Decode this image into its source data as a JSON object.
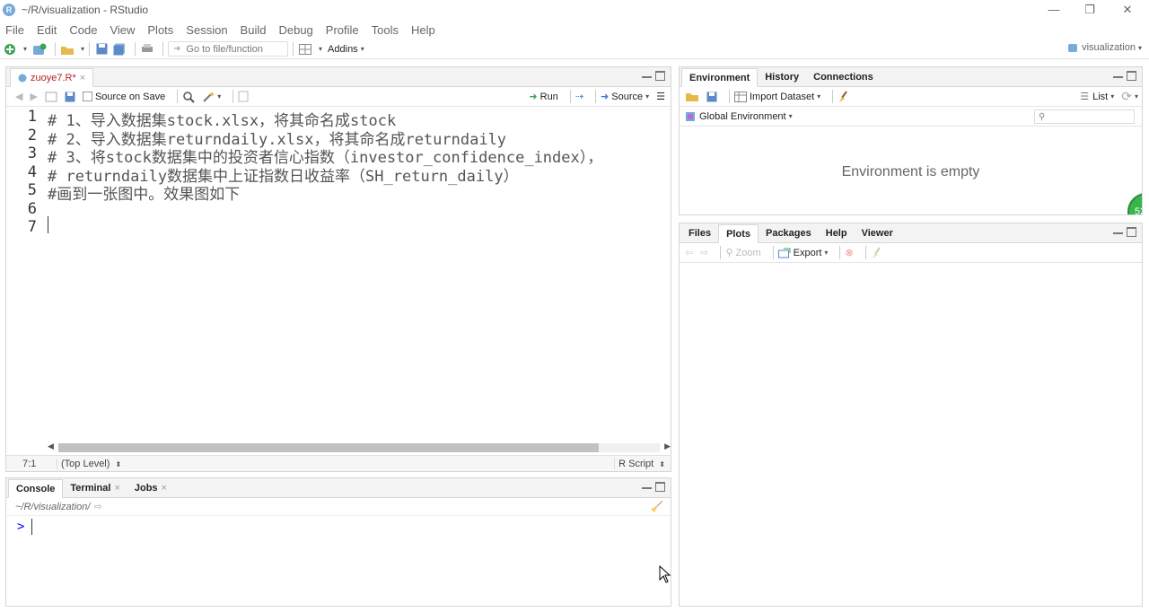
{
  "window": {
    "title": "~/R/visualization - RStudio",
    "r_logo": "R",
    "user_label": "visualization",
    "controls": {
      "minimize": "—",
      "restore": "❐",
      "close": "✕"
    }
  },
  "menu": [
    {
      "label": "File"
    },
    {
      "label": "Edit"
    },
    {
      "label": "Code"
    },
    {
      "label": "View"
    },
    {
      "label": "Plots"
    },
    {
      "label": "Session"
    },
    {
      "label": "Build"
    },
    {
      "label": "Debug"
    },
    {
      "label": "Profile"
    },
    {
      "label": "Tools"
    },
    {
      "label": "Help"
    }
  ],
  "toolbar": {
    "goto_placeholder": "Go to file/function",
    "addins_label": "Addins"
  },
  "editor": {
    "tab_label": "zuoye7.R*",
    "source_on_save": "Source on Save",
    "run_label": "Run",
    "source_label": "Source",
    "line_numbers": [
      "1",
      "2",
      "3",
      "4",
      "5",
      "6",
      "7"
    ],
    "lines": [
      "# 1、导入数据集stock.xlsx，将其命名成stock",
      "# 2、导入数据集returndaily.xlsx，将其命名成returndaily",
      "# 3、将stock数据集中的投资者信心指数（investor_confidence_index），",
      "# returndaily数据集中上证指数日收益率（SH_return_daily）",
      "#画到一张图中。效果图如下",
      "",
      ""
    ],
    "status_position": "7:1",
    "status_scope": "(Top Level)",
    "status_type": "R Script"
  },
  "console": {
    "tabs": [
      {
        "label": "Console"
      },
      {
        "label": "Terminal"
      },
      {
        "label": "Jobs"
      }
    ],
    "path": "~/R/visualization/",
    "prompt": ">"
  },
  "environment": {
    "tabs": [
      {
        "label": "Environment"
      },
      {
        "label": "History"
      },
      {
        "label": "Connections"
      }
    ],
    "import_dataset": "Import Dataset",
    "list_label": "List",
    "scope": "Global Environment",
    "empty_message": "Environment is empty",
    "badge": "52"
  },
  "files": {
    "tabs": [
      {
        "label": "Files"
      },
      {
        "label": "Plots"
      },
      {
        "label": "Packages"
      },
      {
        "label": "Help"
      },
      {
        "label": "Viewer"
      }
    ],
    "zoom_label": "Zoom",
    "export_label": "Export"
  }
}
